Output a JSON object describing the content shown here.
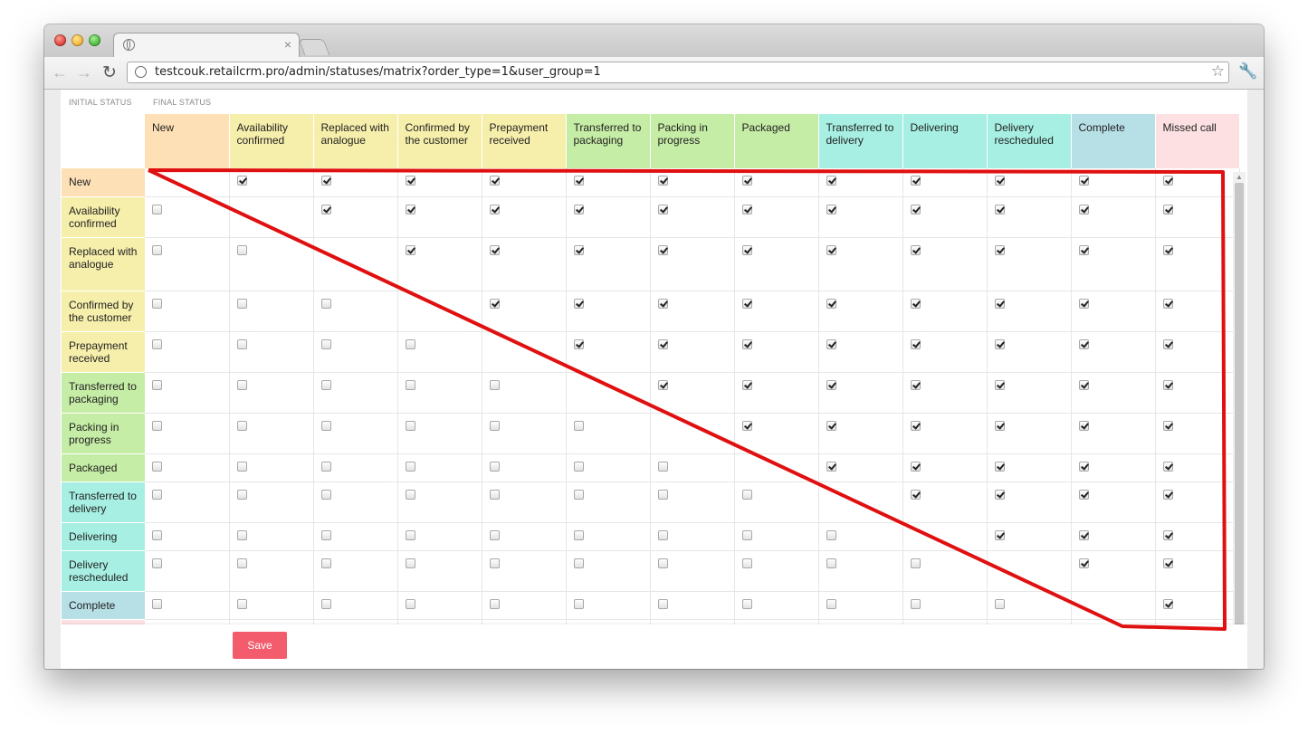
{
  "browser": {
    "tab_title": "",
    "url": "testcouk.retailcrm.pro/admin/statuses/matrix?order_type=1&user_group=1"
  },
  "page": {
    "initial_status_label": "INITIAL STATUS",
    "final_status_label": "FINAL STATUS",
    "save_label": "Save"
  },
  "columns": [
    {
      "label": "New",
      "color": "#fde0b6"
    },
    {
      "label": "Availability confirmed",
      "color": "#f6eeab"
    },
    {
      "label": "Replaced with analogue",
      "color": "#f6eeab"
    },
    {
      "label": "Confirmed by the customer",
      "color": "#f6eeab"
    },
    {
      "label": "Prepayment received",
      "color": "#f6eeab"
    },
    {
      "label": "Transferred to packaging",
      "color": "#c6eda6"
    },
    {
      "label": "Packing in progress",
      "color": "#c6eda6"
    },
    {
      "label": "Packaged",
      "color": "#c6eda6"
    },
    {
      "label": "Transferred to delivery",
      "color": "#a6efe2"
    },
    {
      "label": "Delivering",
      "color": "#a6efe2"
    },
    {
      "label": "Delivery rescheduled",
      "color": "#a6efe2"
    },
    {
      "label": "Complete",
      "color": "#b7dfe6"
    },
    {
      "label": "Missed call",
      "color": "#fde0e2"
    }
  ],
  "rows": [
    {
      "label": "New",
      "color": "#fde0b6",
      "height": 31,
      "cells": [
        null,
        true,
        true,
        true,
        true,
        true,
        true,
        true,
        true,
        true,
        true,
        true,
        true
      ]
    },
    {
      "label": "Availability confirmed",
      "color": "#f6eeab",
      "height": 45,
      "cells": [
        false,
        null,
        true,
        true,
        true,
        true,
        true,
        true,
        true,
        true,
        true,
        true,
        true
      ]
    },
    {
      "label": "Replaced with analogue",
      "color": "#f6eeab",
      "height": 59,
      "cells": [
        false,
        false,
        null,
        true,
        true,
        true,
        true,
        true,
        true,
        true,
        true,
        true,
        true
      ]
    },
    {
      "label": "Confirmed by the customer",
      "color": "#f6eeab",
      "height": 45,
      "cells": [
        false,
        false,
        false,
        null,
        true,
        true,
        true,
        true,
        true,
        true,
        true,
        true,
        true
      ]
    },
    {
      "label": "Prepayment received",
      "color": "#f6eeab",
      "height": 45,
      "cells": [
        false,
        false,
        false,
        false,
        null,
        true,
        true,
        true,
        true,
        true,
        true,
        true,
        true
      ]
    },
    {
      "label": "Transferred to packaging",
      "color": "#c6eda6",
      "height": 45,
      "cells": [
        false,
        false,
        false,
        false,
        false,
        null,
        true,
        true,
        true,
        true,
        true,
        true,
        true
      ]
    },
    {
      "label": "Packing in progress",
      "color": "#c6eda6",
      "height": 45,
      "cells": [
        false,
        false,
        false,
        false,
        false,
        false,
        null,
        true,
        true,
        true,
        true,
        true,
        true
      ]
    },
    {
      "label": "Packaged",
      "color": "#c6eda6",
      "height": 31,
      "cells": [
        false,
        false,
        false,
        false,
        false,
        false,
        false,
        null,
        true,
        true,
        true,
        true,
        true
      ]
    },
    {
      "label": "Transferred to delivery",
      "color": "#a6efe2",
      "height": 45,
      "cells": [
        false,
        false,
        false,
        false,
        false,
        false,
        false,
        false,
        null,
        true,
        true,
        true,
        true
      ]
    },
    {
      "label": "Delivering",
      "color": "#a6efe2",
      "height": 31,
      "cells": [
        false,
        false,
        false,
        false,
        false,
        false,
        false,
        false,
        false,
        null,
        true,
        true,
        true
      ]
    },
    {
      "label": "Delivery rescheduled",
      "color": "#a6efe2",
      "height": 45,
      "cells": [
        false,
        false,
        false,
        false,
        false,
        false,
        false,
        false,
        false,
        false,
        null,
        true,
        true
      ]
    },
    {
      "label": "Complete",
      "color": "#b7dfe6",
      "height": 31,
      "cells": [
        false,
        false,
        false,
        false,
        false,
        false,
        false,
        false,
        false,
        false,
        false,
        null,
        true
      ]
    },
    {
      "label": "",
      "color": "#fde0e2",
      "height": 31,
      "cells": [
        false,
        false,
        false,
        false,
        false,
        false,
        false,
        false,
        false,
        false,
        false,
        false,
        null
      ]
    }
  ],
  "annotation": {
    "color": "#e01010"
  }
}
